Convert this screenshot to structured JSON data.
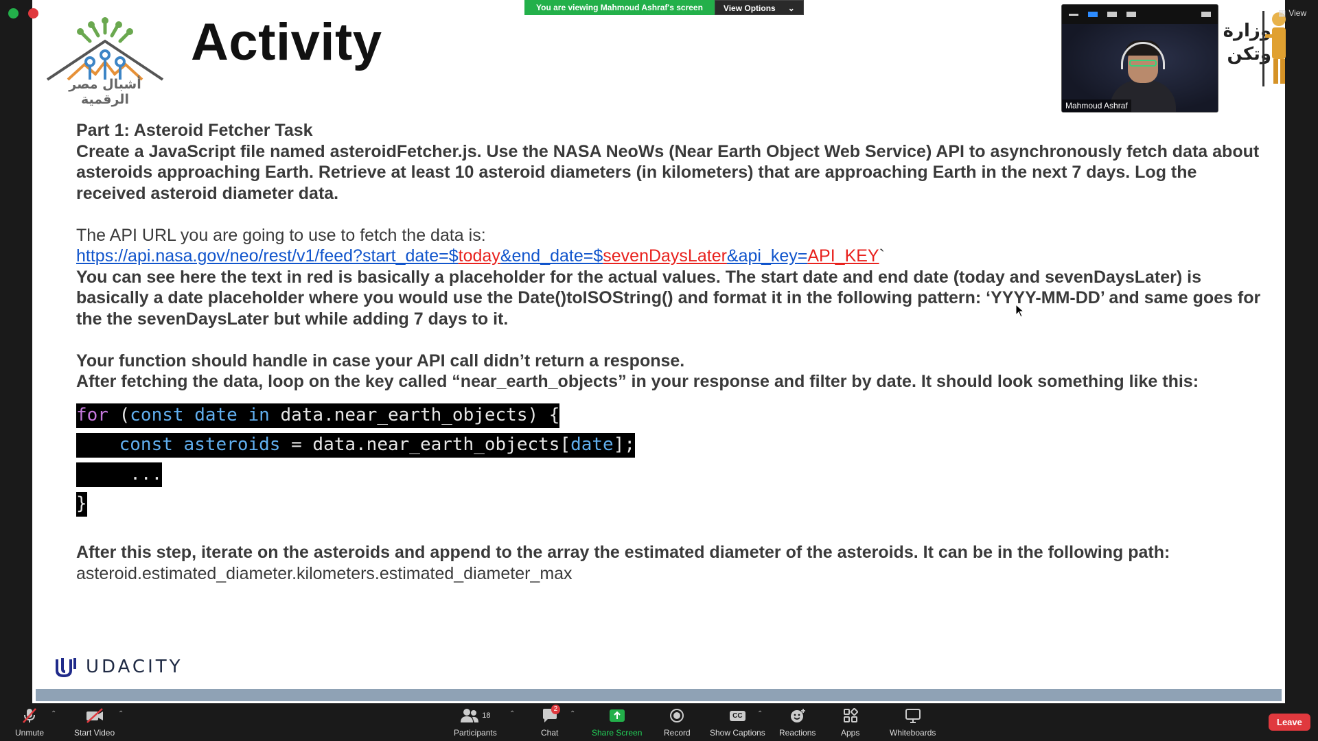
{
  "zoom": {
    "viewing_banner": "You are viewing Mahmoud Ashraf's screen",
    "view_options": "View Options",
    "view_label": "View",
    "participant_name": "Mahmoud Ashraf",
    "toolbar": {
      "unmute": "Unmute",
      "start_video": "Start Video",
      "participants": "Participants",
      "participant_count": "18",
      "chat": "Chat",
      "chat_badge": "2",
      "share_screen": "Share Screen",
      "record": "Record",
      "show_captions": "Show Captions",
      "reactions": "Reactions",
      "apps": "Apps",
      "whiteboards": "Whiteboards",
      "leave": "Leave"
    },
    "colors": {
      "share_green": "#23b04a",
      "leave_red": "#e0393e",
      "accent_blue": "#2d8cff"
    }
  },
  "slide": {
    "title": "Activity",
    "logo_text": "أشبال مصر الرقمية",
    "ministry_text": [
      "وزارة",
      "وتكن"
    ],
    "part_heading": "Part 1: Asteroid Fetcher Task",
    "intro": "Create a JavaScript file named asteroidFetcher.js. Use the NASA NeoWs (Near Earth Object Web Service) API to asynchronously fetch data about asteroids approaching Earth. Retrieve at least 10 asteroid diameters (in kilometers) that are approaching Earth in the next 7 days. Log the received asteroid diameter data.",
    "url_label": "The API URL you are going to use to fetch the data is:",
    "url_parts": {
      "p1": "https://api.nasa.gov/neo/rest/v1/feed?start_date=$",
      "p2": "today",
      "p3": "&end_date=$",
      "p4": "sevenDaysLater",
      "p5": "&api_key=",
      "p6": "API_KEY",
      "p7": "`"
    },
    "placeholder_note": "You can see here the text in red is basically a placeholder for the actual values. The start date and end date (today and sevenDaysLater) is basically a date placeholder where you would use the Date()toISOString() and format it in the following pattern: ‘YYYY-MM-DD’ and same goes for the the sevenDaysLater but while adding 7 days to it.",
    "handle_note": "Your function should handle in case your API call didn’t return a response.",
    "loop_note": "After fetching the data, loop on the key called “near_earth_objects” in your response and filter by date. It should look something like this:",
    "code": {
      "l1_for": "for",
      "l1_open": " (",
      "l1_const": "const",
      "l1_date": " date",
      "l1_in": " in",
      "l1_rest": " data.near_earth_objects) {",
      "l2_indent": "    ",
      "l2_const": "const",
      "l2_asteroids": " asteroids",
      "l2_eq": " = data.near_earth_objects[",
      "l2_date": "date",
      "l2_end": "];",
      "l3": "     ...",
      "l4": "}"
    },
    "after_step": "After this step, iterate on the asteroids and append to the array the estimated diameter of the asteroids. It can be in the following path:",
    "path": "asteroid.estimated_diameter.kilometers.estimated_diameter_max",
    "brand": "UDACITY"
  }
}
